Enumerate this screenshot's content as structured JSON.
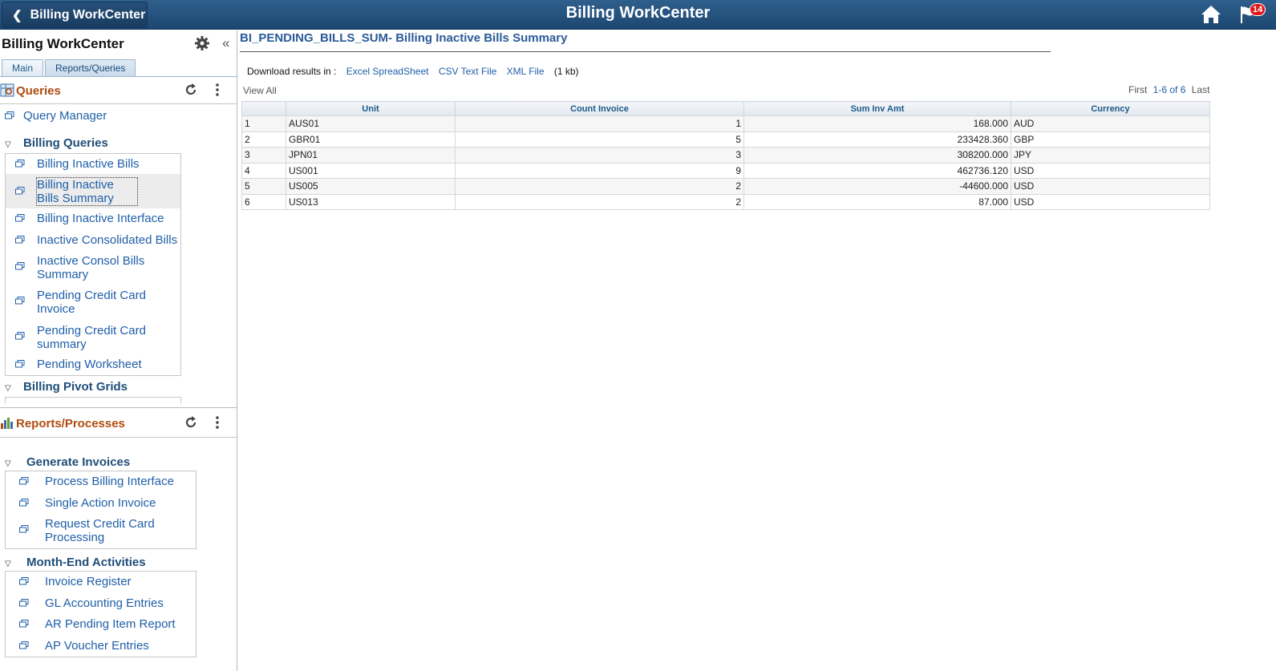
{
  "header": {
    "back_label": "Billing WorkCenter",
    "title": "Billing WorkCenter",
    "notification_count": "14"
  },
  "left": {
    "title": "Billing WorkCenter",
    "tabs": [
      {
        "label": "Main"
      },
      {
        "label": "Reports/Queries"
      }
    ],
    "queries": {
      "title": "Queries",
      "query_manager": "Query Manager",
      "billing_queries": {
        "label": "Billing Queries",
        "items": [
          {
            "label": "Billing Inactive Bills"
          },
          {
            "label": "Billing Inactive Bills Summary"
          },
          {
            "label": "Billing Inactive Interface"
          },
          {
            "label": "Inactive Consolidated Bills"
          },
          {
            "label": "Inactive Consol Bills Summary"
          },
          {
            "label": "Pending Credit Card Invoice"
          },
          {
            "label": "Pending Credit Card summary"
          },
          {
            "label": "Pending Worksheet"
          }
        ]
      },
      "billing_pivot_grids": {
        "label": "Billing Pivot Grids"
      }
    },
    "reports": {
      "title": "Reports/Processes",
      "generate_invoices": {
        "label": "Generate Invoices",
        "items": [
          {
            "label": "Process Billing Interface"
          },
          {
            "label": "Single Action Invoice"
          },
          {
            "label": "Request Credit Card Processing"
          }
        ]
      },
      "month_end": {
        "label": "Month-End Activities",
        "items": [
          {
            "label": "Invoice Register"
          },
          {
            "label": "GL Accounting Entries"
          },
          {
            "label": "AR Pending Item Report"
          },
          {
            "label": "AP Voucher Entries"
          }
        ]
      }
    }
  },
  "main": {
    "title": "BI_PENDING_BILLS_SUM- Billing Inactive Bills Summary",
    "download": {
      "prefix": "Download results in :",
      "excel": "Excel SpreadSheet",
      "csv": "CSV Text File",
      "xml": "XML File",
      "size": "(1 kb)"
    },
    "view_all": "View All",
    "pager": {
      "first": "First",
      "range": "1-6 of 6",
      "last": "Last"
    },
    "table": {
      "headers": [
        "",
        "Unit",
        "Count Invoice",
        "Sum Inv Amt",
        "Currency"
      ],
      "rows": [
        {
          "n": "1",
          "unit": "AUS01",
          "count": "1",
          "sum": "168.000",
          "currency": "AUD"
        },
        {
          "n": "2",
          "unit": "GBR01",
          "count": "5",
          "sum": "233428.360",
          "currency": "GBP"
        },
        {
          "n": "3",
          "unit": "JPN01",
          "count": "3",
          "sum": "308200.000",
          "currency": "JPY"
        },
        {
          "n": "4",
          "unit": "US001",
          "count": "9",
          "sum": "462736.120",
          "currency": "USD"
        },
        {
          "n": "5",
          "unit": "US005",
          "count": "2",
          "sum": "-44600.000",
          "currency": "USD"
        },
        {
          "n": "6",
          "unit": "US013",
          "count": "2",
          "sum": "87.000",
          "currency": "USD"
        }
      ]
    }
  },
  "colors": {
    "banner": "#1d4772",
    "link": "#1f5fa8",
    "section_title": "#b04b0f",
    "group_title": "#1f4e79",
    "badge": "#e01818"
  }
}
